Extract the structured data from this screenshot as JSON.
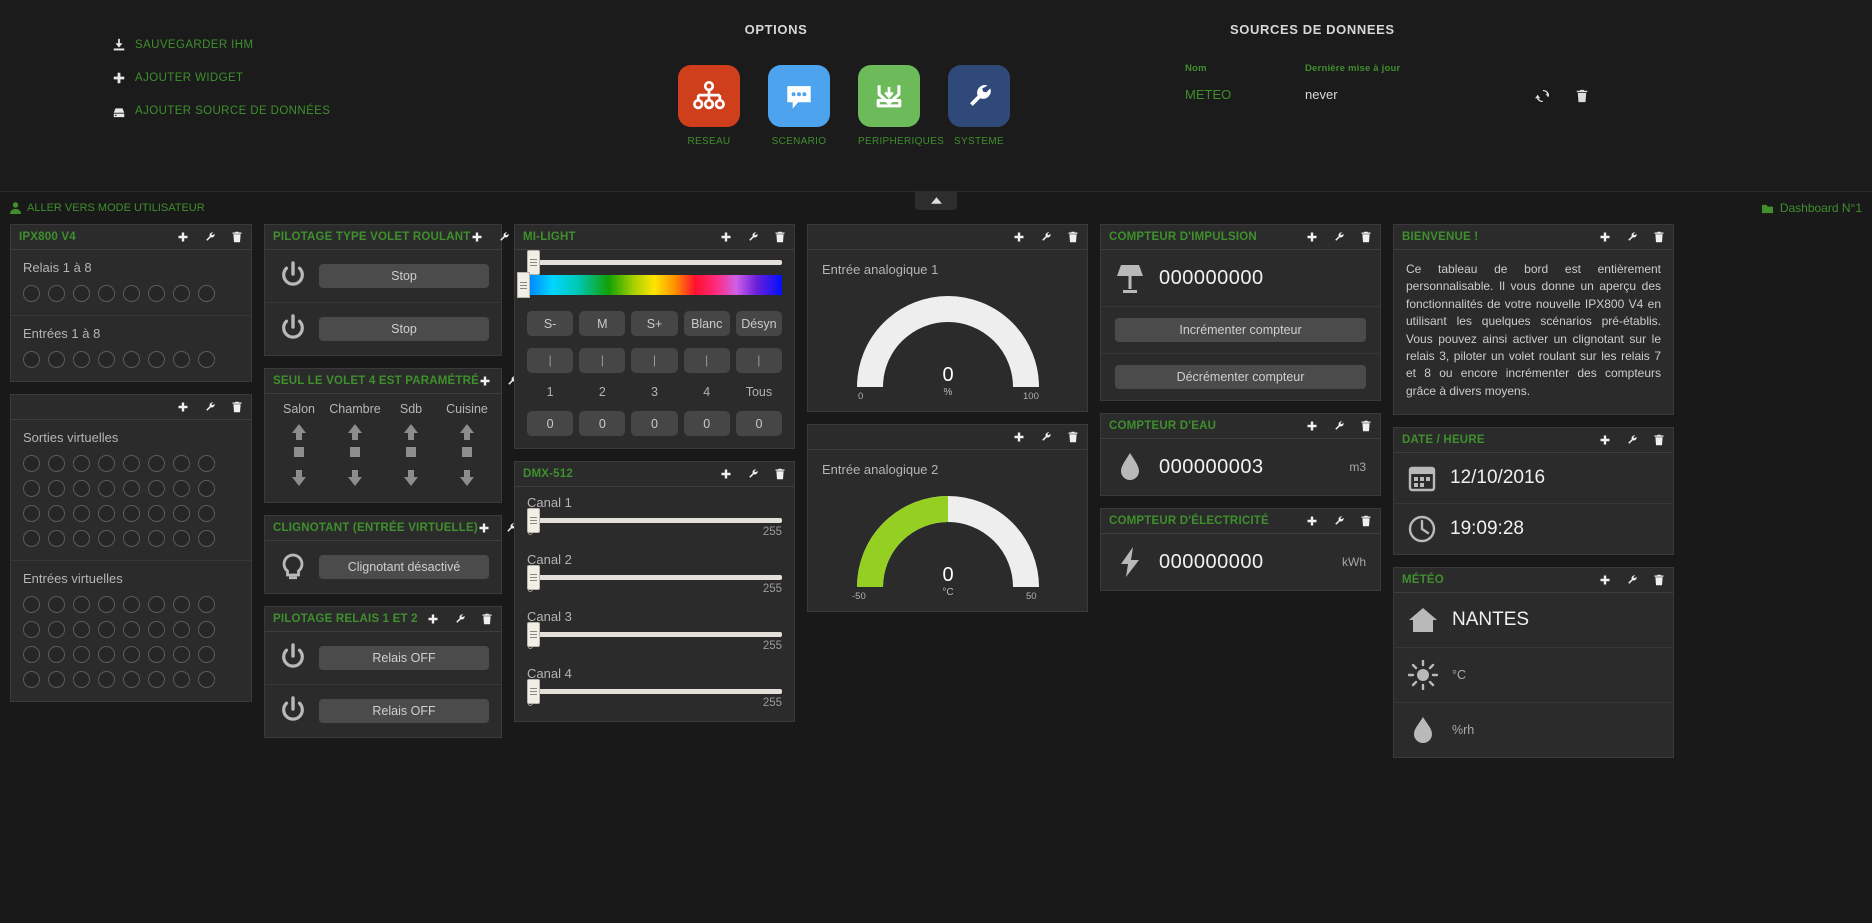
{
  "top": {
    "admin_links": [
      {
        "label": "SAUVEGARDER IHM",
        "icon": "save-download-icon"
      },
      {
        "label": "AJOUTER WIDGET",
        "icon": "plus-icon"
      },
      {
        "label": "AJOUTER SOURCE DE DONNÉES",
        "icon": "database-icon"
      }
    ],
    "options_title": "OPTIONS",
    "options": [
      {
        "label": "RESEAU",
        "color": "#cf3f1c",
        "icon": "network-tree-icon"
      },
      {
        "label": "SCENARIO",
        "color": "#4ea3ee",
        "icon": "chat-bubble-icon"
      },
      {
        "label": "PERIPHERIQUES",
        "color": "#6cba5a",
        "icon": "inbox-download-icon"
      },
      {
        "label": "SYSTEME",
        "color": "#2f4a78",
        "icon": "wrench-icon"
      }
    ],
    "sources_title": "SOURCES DE DONNEES",
    "sources_headers": [
      "Nom",
      "Dernière mise à jour",
      ""
    ],
    "sources_rows": [
      {
        "name": "METEO",
        "updated": "never"
      }
    ],
    "collapse_icon": "chevron-up-icon"
  },
  "subbar": {
    "user_mode": "ALLER VERS MODE UTILISATEUR",
    "dashboard": "Dashboard N°1"
  },
  "widgets": {
    "ipx800": {
      "title": "IPX800 V4",
      "sections": [
        {
          "label": "Relais 1 à  8",
          "count": 8
        },
        {
          "label": "Entrées 1 à  8",
          "count": 8
        }
      ]
    },
    "virtual": {
      "title": "",
      "sections": [
        {
          "label": "Sorties virtuelles",
          "count": 32
        },
        {
          "label": "Entrées virtuelles",
          "count": 32
        }
      ]
    },
    "volet": {
      "title": "PILOTAGE TYPE VOLET ROULANT",
      "rows": [
        {
          "label": "Stop",
          "icon": "power-icon"
        },
        {
          "label": "Stop",
          "icon": "power-icon"
        }
      ]
    },
    "volet4": {
      "title": "SEUL LE VOLET 4 EST PARAMÉTRÉ",
      "shutters": [
        "Salon",
        "Chambre",
        "Sdb",
        "Cuisine"
      ]
    },
    "clignotant": {
      "title": "CLIGNOTANT (ENTRÉE VIRTUELLE)",
      "button": "Clignotant désactivé",
      "icon": "bulb-icon"
    },
    "relais12": {
      "title": "PILOTAGE RELAIS 1 ET 2",
      "rows": [
        {
          "label": "Relais OFF",
          "icon": "power-icon"
        },
        {
          "label": "Relais OFF",
          "icon": "power-icon"
        }
      ]
    },
    "milight": {
      "title": "MI-LIGHT",
      "brightness": 0,
      "hue": 0,
      "mode_buttons": [
        "S-",
        "M",
        "S+",
        "Blanc",
        "Désyn"
      ],
      "zone_bars": [
        "|",
        "|",
        "|",
        "|",
        "|"
      ],
      "zone_labels": [
        "1",
        "2",
        "3",
        "4",
        "Tous"
      ],
      "zone_values": [
        "0",
        "0",
        "0",
        "0",
        "0"
      ]
    },
    "dmx": {
      "title": "DMX-512",
      "channels": [
        {
          "name": "Canal 1",
          "value": "0",
          "max": "255"
        },
        {
          "name": "Canal 2",
          "value": "0",
          "max": "255"
        },
        {
          "name": "Canal 3",
          "value": "0",
          "max": "255"
        },
        {
          "name": "Canal 4",
          "value": "0",
          "max": "255"
        }
      ]
    },
    "analog1": {
      "label": "Entrée analogique 1",
      "value": "0",
      "unit": "%",
      "min": "0",
      "max": "100",
      "fill_pct": 0,
      "fill_color": "#95cf22"
    },
    "analog2": {
      "label": "Entrée analogique 2",
      "value": "0",
      "unit": "°C",
      "min": "-50",
      "max": "50",
      "fill_pct": 50,
      "fill_color": "#95cf22"
    },
    "impulsion": {
      "title": "COMPTEUR D'IMPULSION",
      "value": "000000000",
      "icon": "lamp-icon",
      "buttons": [
        "Incrémenter compteur",
        "Décrémenter compteur"
      ]
    },
    "eau": {
      "title": "COMPTEUR D'EAU",
      "value": "000000003",
      "unit": "m3",
      "icon": "water-drop-icon"
    },
    "electricite": {
      "title": "COMPTEUR D'ÉLECTRICITÉ",
      "value": "000000000",
      "unit": "kWh",
      "icon": "bolt-icon"
    },
    "bienvenue": {
      "title": "BIENVENUE !",
      "text": "Ce tableau de bord est entièrement personnalisable. Il vous donne un aperçu des fonctionnalités de votre nouvelle IPX800 V4 en utilisant les quelques scénarios pré-établis. Vous pouvez ainsi activer un clignotant sur le relais 3, piloter un volet roulant sur les relais 7 et 8 ou encore incrémenter des compteurs grâce à divers moyens."
    },
    "datetime": {
      "title": "DATE / HEURE",
      "date": "12/10/2016",
      "time": "19:09:28",
      "date_icon": "calendar-icon",
      "time_icon": "clock-icon"
    },
    "meteo": {
      "title": "MÉTÉO",
      "city": "NANTES",
      "city_icon": "house-icon",
      "rows": [
        {
          "icon": "sun-icon",
          "unit": "°C"
        },
        {
          "icon": "humidity-icon",
          "unit": "%rh"
        }
      ]
    }
  },
  "icons": {
    "plus": "plus-icon",
    "wrench": "wrench-icon",
    "trash": "trash-icon",
    "refresh": "refresh-icon"
  }
}
